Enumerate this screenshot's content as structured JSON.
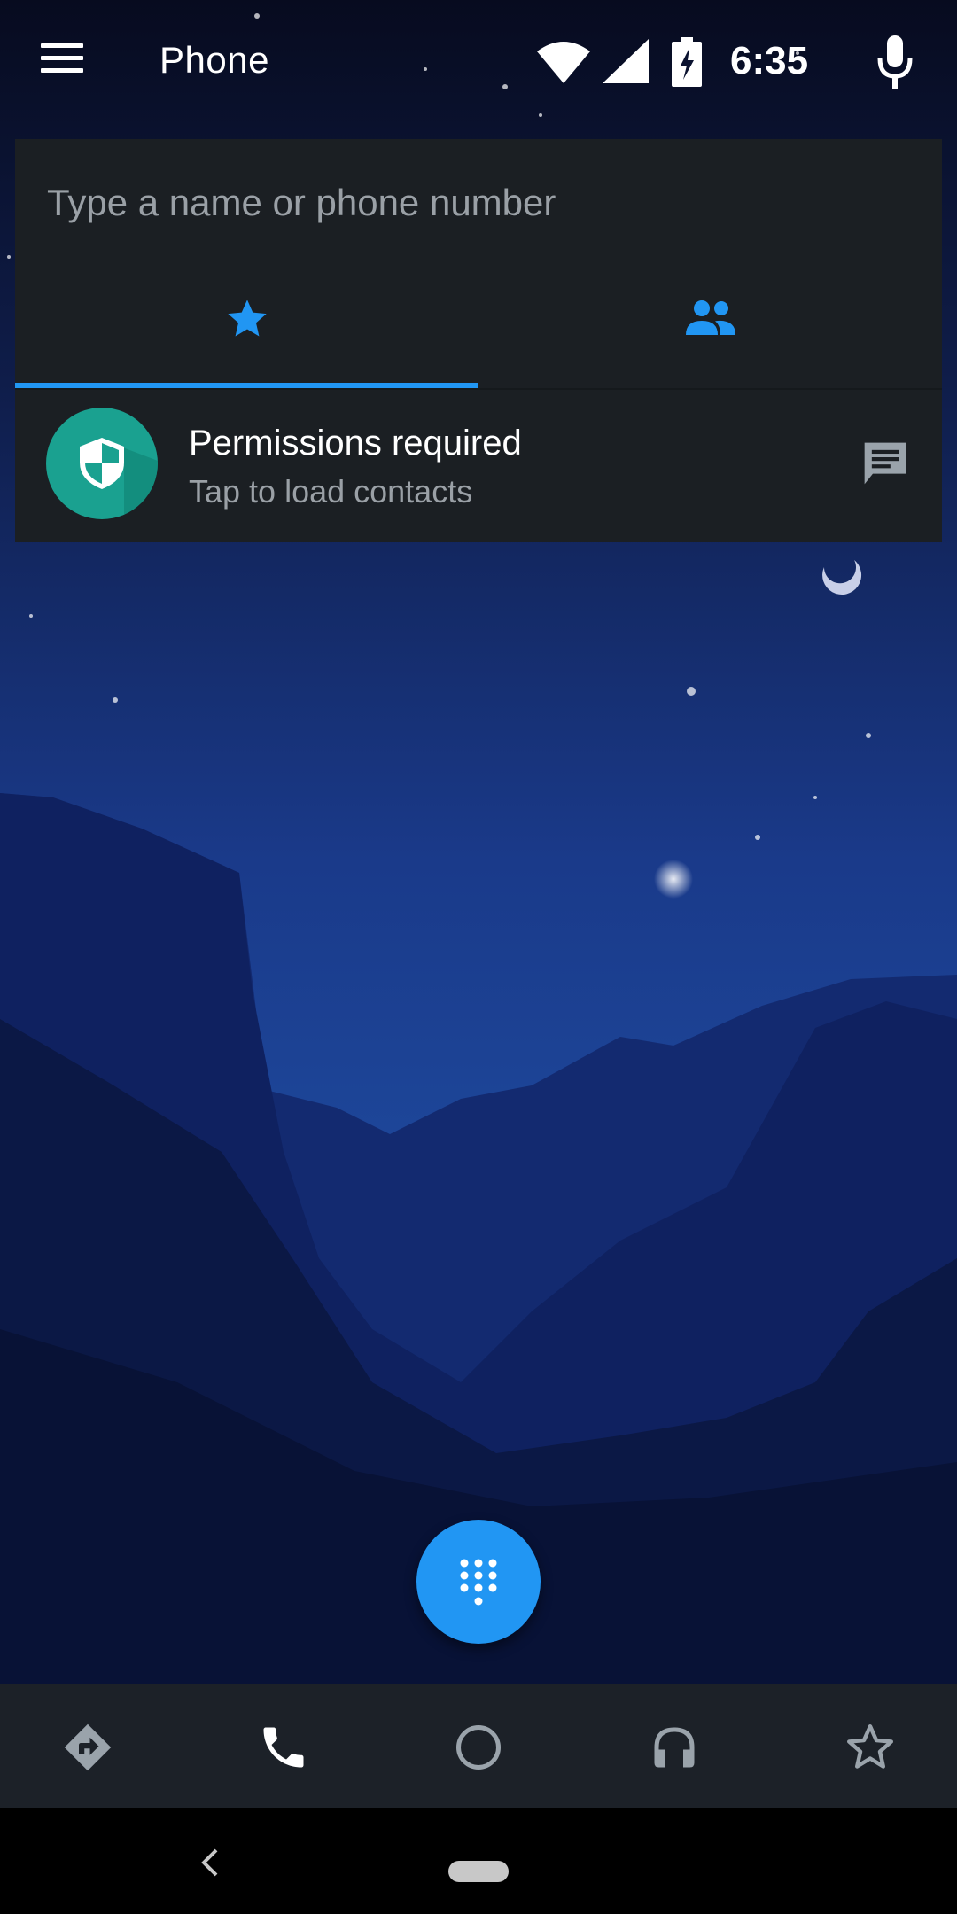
{
  "app": {
    "title": "Phone"
  },
  "status_bar": {
    "time": "6:35",
    "icons": [
      "wifi-icon",
      "signal-icon",
      "battery-charging-icon",
      "mic-icon"
    ]
  },
  "search": {
    "placeholder": "Type a name or phone number"
  },
  "tabs": [
    {
      "name": "favorites",
      "icon": "star-icon",
      "selected": true
    },
    {
      "name": "contacts",
      "icon": "people-icon",
      "selected": false
    }
  ],
  "permission_card": {
    "title": "Permissions required",
    "subtitle": "Tap to load contacts",
    "icon": "shield-icon",
    "action_icon": "message-icon"
  },
  "fab": {
    "icon": "dialpad-icon"
  },
  "bottom_nav": [
    "directions-icon",
    "phone-icon",
    "circle-icon",
    "headphones-icon",
    "star-outline-icon"
  ],
  "colors": {
    "accent": "#2196f3",
    "panel": "#1b1f23",
    "avatar": "#1aa190",
    "bottom_bar": "#1c2128"
  }
}
